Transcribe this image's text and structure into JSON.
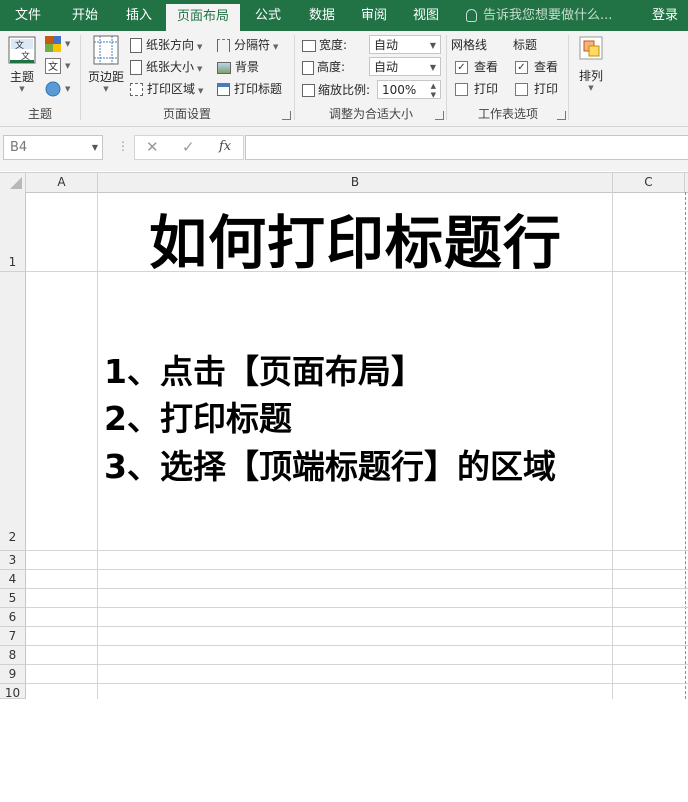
{
  "tabs": [
    "文件",
    "开始",
    "插入",
    "页面布局",
    "公式",
    "数据",
    "审阅",
    "视图"
  ],
  "active_tab": "页面布局",
  "tell_me": "告诉我您想要做什么...",
  "login": "登录",
  "ribbon": {
    "theme": {
      "button": "主题",
      "group": "主题"
    },
    "page_setup": {
      "margins": "页边距",
      "orientation": "纸张方向",
      "size": "纸张大小",
      "print_area": "打印区域",
      "breaks": "分隔符",
      "background": "背景",
      "print_titles": "打印标题",
      "group": "页面设置"
    },
    "scale": {
      "width_label": "宽度:",
      "width_value": "自动",
      "height_label": "高度:",
      "height_value": "自动",
      "scale_label": "缩放比例:",
      "scale_value": "100%",
      "group": "调整为合适大小"
    },
    "sheet_options": {
      "gridlines": "网格线",
      "headings": "标题",
      "view": "查看",
      "print": "打印",
      "group": "工作表选项"
    },
    "arrange": {
      "button": "排列"
    }
  },
  "formula_bar": {
    "name_box": "B4",
    "fx": "fx"
  },
  "columns": [
    "A",
    "B",
    "C"
  ],
  "rows": [
    "1",
    "2",
    "3",
    "4",
    "5",
    "6",
    "7",
    "8",
    "9",
    "10"
  ],
  "sheet": {
    "title": "如何打印标题行",
    "steps": [
      "1、点击【页面布局】",
      "2、打印标题",
      "3、选择【顶端标题行】的区域"
    ]
  },
  "colors": {
    "accent": "#217346"
  }
}
